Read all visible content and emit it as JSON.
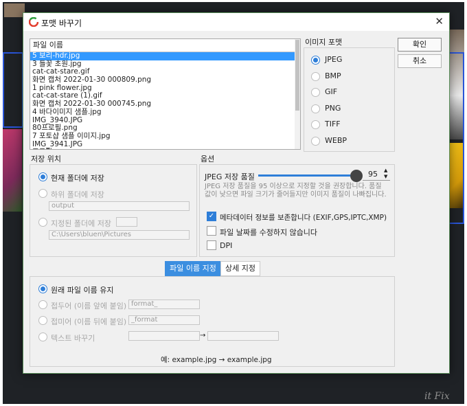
{
  "dialog": {
    "title": "포맷 바꾸기",
    "ok_label": "확인",
    "cancel_label": "취소"
  },
  "file_list": {
    "header": "파일 이름",
    "items": [
      "5 보리-hdr.jpg",
      "3 들꽃 초원.jpg",
      "cat-cat-stare.gif",
      "화면 캡처 2022-01-30 000809.png",
      "1 pink flower.jpg",
      "cat-cat-stare (1).gif",
      "화면 캡처 2022-01-30 000745.png",
      "4 바다이미지 샘플.jpg",
      "IMG_3940.JPG",
      "80프로필.png",
      "7 포토샵 샘플 이미지.jpg",
      "IMG_3941.JPG",
      "프로필.png"
    ],
    "selected_index": 0
  },
  "image_format": {
    "label": "이미지 포맷",
    "options": [
      "JPEG",
      "BMP",
      "GIF",
      "PNG",
      "TIFF",
      "WEBP"
    ],
    "selected": "JPEG"
  },
  "save_location": {
    "label": "저장 위치",
    "current_folder": "현재 폴더에 저장",
    "subfolder": "하위 폴더에 저장",
    "subfolder_value": "output",
    "specified_folder": "지정된 폴더에 저장",
    "specified_value": "C:\\Users\\bluen\\Pictures",
    "selected": "current_folder"
  },
  "options": {
    "label": "옵션",
    "quality_label": "JPEG 저장 품질",
    "quality_value": "95",
    "quality_fraction": 0.95,
    "quality_hint": "JPEG 저장 품질을 95 이상으로 지정할 것을 권장합니다. 품질 값이 낮으면 파일 크기가 줄어들지만 이미지 품질이 나빠집니다.",
    "keep_metadata": "메타데이터 정보를 보존합니다 (EXIF,GPS,IPTC,XMP)",
    "keep_metadata_checked": true,
    "keep_date": "파일 날짜를 수정하지 않습니다",
    "keep_date_checked": false,
    "dpi": "DPI",
    "dpi_checked": false
  },
  "tabs": {
    "filename": "파일 이름 지정",
    "detail": "상세 지정",
    "active": "filename"
  },
  "naming": {
    "keep_original": "원래 파일 이름 유지",
    "prefix": "접두어 (이름 앞에 붙임)",
    "prefix_value": "format_",
    "suffix": "접미어 (이름 뒤에 붙임)",
    "suffix_value": "_format",
    "replace": "텍스트 바꾸기",
    "replace_arrow": "→",
    "example": "예: example.jpg → example.jpg",
    "selected": "keep_original"
  },
  "watermark": "it Fix",
  "colors": {
    "accent": "#2e7ed8",
    "selection": "#3399ff",
    "tab_active": "#3b8ee0"
  }
}
